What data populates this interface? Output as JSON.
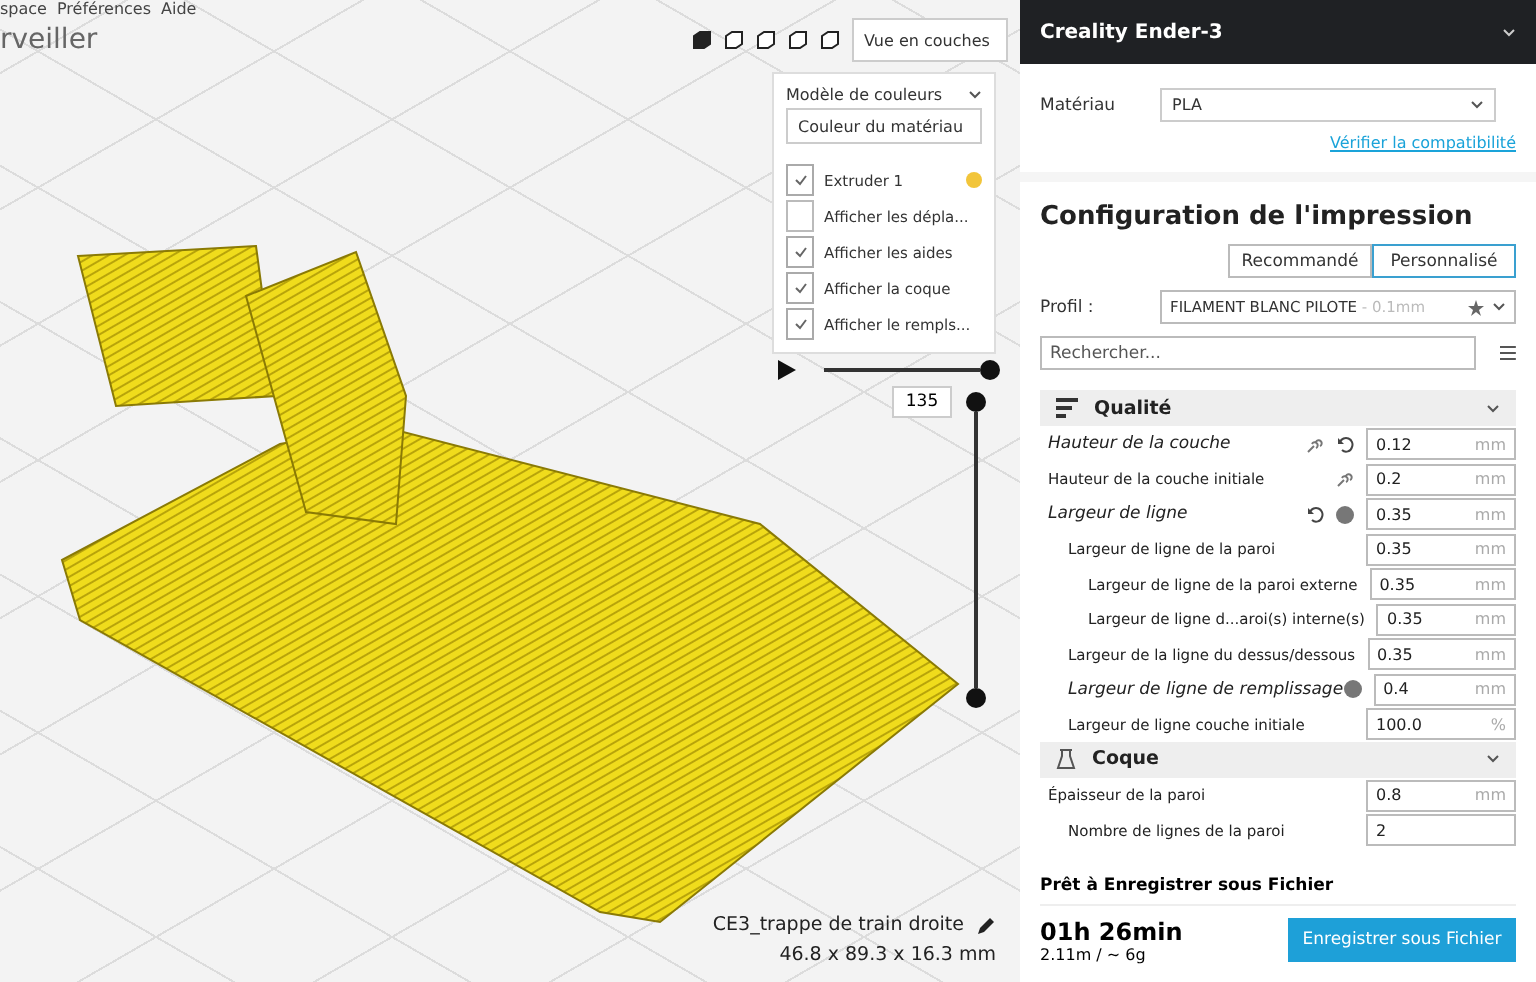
{
  "menu_bar": {
    "items": [
      "space",
      "Préférences",
      "Aide"
    ]
  },
  "stage_tab": {
    "label": "rveiller"
  },
  "view_toolbar": {
    "view_mode": "Vue en couches"
  },
  "color_panel": {
    "title": "Modèle de couleurs",
    "scheme": "Couleur du matériau",
    "options": [
      {
        "label": "Extruder 1",
        "checked": true,
        "color": "#f2c53a"
      },
      {
        "label": "Afficher les dépla...",
        "checked": false
      },
      {
        "label": "Afficher les aides",
        "checked": true
      },
      {
        "label": "Afficher la coque",
        "checked": true
      },
      {
        "label": "Afficher le rempls...",
        "checked": true
      }
    ]
  },
  "layer_slider": {
    "layer": "135",
    "level": 1
  },
  "path_slider": {
    "level": 1
  },
  "object_info": {
    "name": "CE3_trappe de train droite",
    "dimensions": "46.8 x 89.3 x 16.3 mm"
  },
  "printer": {
    "name": "Creality Ender-3"
  },
  "material": {
    "label": "Matériau",
    "value": "PLA",
    "link": "Vérifier la compatibilité"
  },
  "print_setup": {
    "title": "Configuration de l'impression",
    "tabs": [
      {
        "label": "Recommandé",
        "selected": false
      },
      {
        "label": "Personnalisé",
        "selected": true
      }
    ],
    "profile_label": "Profil :",
    "profile": "FILAMENT BLANC PILOTE",
    "profile_suffix": " - 0.1mm",
    "search_placeholder": "Rechercher...",
    "categories": [
      {
        "kind": "quality",
        "title": "Qualité",
        "settings": [
          {
            "label": "Hauteur de la couche",
            "value": "0.12",
            "unit": "mm",
            "modified": true,
            "linked": true,
            "resettable": true
          },
          {
            "label": "Hauteur de la couche initiale",
            "value": "0.2",
            "unit": "mm",
            "modified": false,
            "linked": true
          },
          {
            "label": "Largeur de ligne",
            "value": "0.35",
            "unit": "mm",
            "modified": true,
            "resettable": true,
            "info": true,
            "children": [
              {
                "label": "Largeur de ligne de la paroi",
                "value": "0.35",
                "unit": "mm",
                "modified": false,
                "children": [
                  {
                    "label": "Largeur de ligne de la paroi externe",
                    "value": "0.35",
                    "unit": "mm",
                    "modified": false
                  },
                  {
                    "label": "Largeur de ligne d...aroi(s) interne(s)",
                    "value": "0.35",
                    "unit": "mm",
                    "modified": false
                  }
                ]
              },
              {
                "label": "Largeur de la ligne du dessus/dessous",
                "value": "0.35",
                "unit": "mm",
                "modified": false
              },
              {
                "label": "Largeur de ligne de remplissage",
                "value": "0.4",
                "unit": "mm",
                "modified": true,
                "info": true
              },
              {
                "label": "Largeur de ligne couche initiale",
                "value": "100.0",
                "unit": "%",
                "modified": false
              }
            ]
          }
        ]
      },
      {
        "kind": "shell",
        "title": "Coque",
        "settings": [
          {
            "label": "Épaisseur de la paroi",
            "value": "0.8",
            "unit": "mm",
            "modified": false,
            "children": [
              {
                "label": "Nombre de lignes de la paroi",
                "value": "2",
                "modified": false
              }
            ]
          }
        ]
      }
    ]
  },
  "footer": {
    "status": "Prêt à Enregistrer sous Fichier",
    "time": "01h 26min",
    "usage": "2.11m / ~ 6g",
    "button": "Enregistrer sous Fichier"
  }
}
